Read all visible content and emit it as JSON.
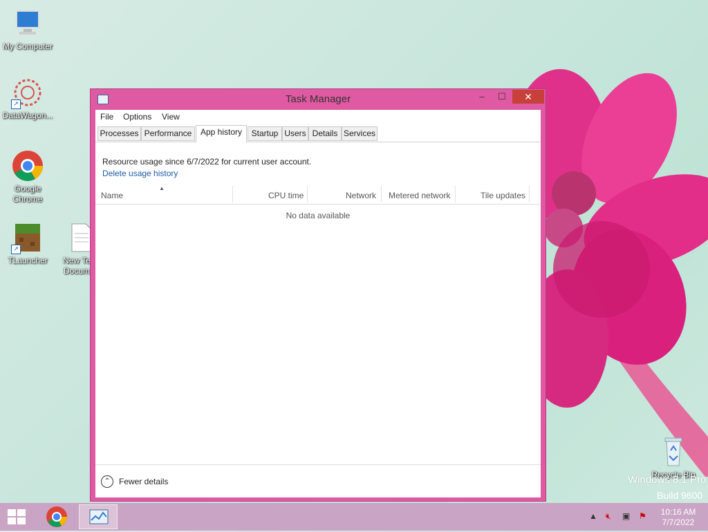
{
  "desktop": {
    "icons": [
      {
        "label": "My Computer"
      },
      {
        "label": "DataWagon..."
      },
      {
        "label": "Google Chrome"
      },
      {
        "label": "TLauncher"
      },
      {
        "label": "New Te... Docum..."
      },
      {
        "label": "Recycle Bin"
      }
    ],
    "watermark_line1": "Windows 8.1 Pro",
    "watermark_line2": "Build 9600"
  },
  "window": {
    "title": "Task Manager",
    "controls": {
      "minimize": "–",
      "maximize": "☐",
      "close": "✕"
    },
    "menu": [
      "File",
      "Options",
      "View"
    ],
    "tabs": [
      {
        "label": "Processes"
      },
      {
        "label": "Performance"
      },
      {
        "label": "App history",
        "active": true
      },
      {
        "label": "Startup"
      },
      {
        "label": "Users"
      },
      {
        "label": "Details"
      },
      {
        "label": "Services"
      }
    ],
    "info_text": "Resource usage since 6/7/2022 for current user account.",
    "delete_link": "Delete usage history",
    "columns": [
      "Name",
      "CPU time",
      "Network",
      "Metered network",
      "Tile updates"
    ],
    "empty_text": "No data available",
    "footer_label": "Fewer details"
  },
  "taskbar": {
    "time": "10:16 AM",
    "date": "7/7/2022",
    "tray_icons": [
      "show-hidden-icons",
      "volume-muted-icon",
      "network-icon",
      "action-center-icon"
    ]
  },
  "colors": {
    "window_frame": "#e05aa3",
    "close_button": "#c7403a",
    "link": "#1e5ba8",
    "taskbar": "#c9a4c4"
  }
}
